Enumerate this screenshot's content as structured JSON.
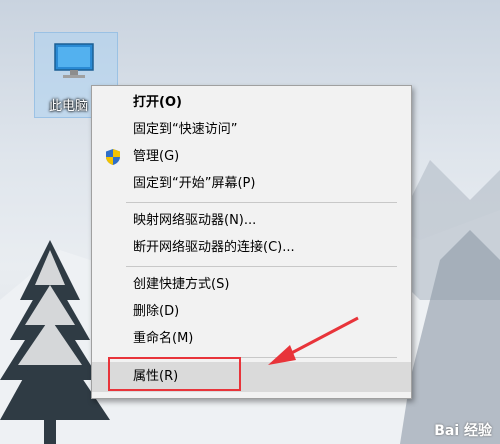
{
  "desktop": {
    "icon_label": "此电脑"
  },
  "context_menu": {
    "items": [
      {
        "label": "打开(O)"
      },
      {
        "label": "固定到“快速访问”"
      },
      {
        "label": "管理(G)"
      },
      {
        "label": "固定到“开始”屏幕(P)"
      },
      {
        "label": "映射网络驱动器(N)..."
      },
      {
        "label": "断开网络驱动器的连接(C)..."
      },
      {
        "label": "创建快捷方式(S)"
      },
      {
        "label": "删除(D)"
      },
      {
        "label": "重命名(M)"
      },
      {
        "label": "属性(R)"
      }
    ]
  },
  "watermark": {
    "text": "Bai 经验"
  },
  "colors": {
    "highlight_box": "#e8343a",
    "arrow": "#e8343a"
  }
}
